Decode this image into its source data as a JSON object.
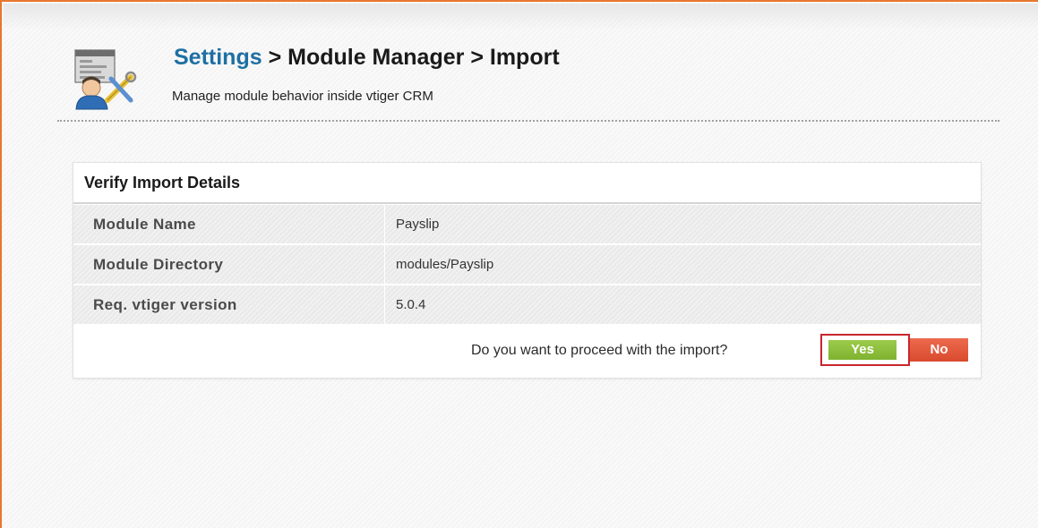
{
  "header": {
    "breadcrumb": {
      "settings": "Settings",
      "sep1": " > ",
      "module_manager": "Module Manager",
      "sep2": " > ",
      "current": "Import"
    },
    "subtitle": "Manage module behavior inside vtiger CRM",
    "icon": "settings-tools-icon"
  },
  "panel": {
    "title": "Verify Import Details",
    "rows": [
      {
        "label": "Module Name",
        "value": "Payslip"
      },
      {
        "label": "Module Directory",
        "value": "modules/Payslip"
      },
      {
        "label": "Req. vtiger version",
        "value": "5.0.4"
      }
    ],
    "question": "Do you want to proceed with the import?",
    "yes_label": "Yes",
    "no_label": "No"
  },
  "colors": {
    "accent_border": "#e8762f",
    "link": "#1e6fa3",
    "yes_button": "#8bbf3a",
    "no_button": "#e05a3c",
    "highlight": "#c8262c"
  }
}
